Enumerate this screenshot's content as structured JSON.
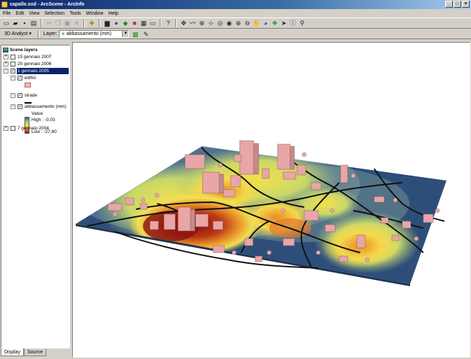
{
  "window": {
    "title": "capalle.sxd - ArcScene - ArcInfo",
    "buttons": [
      "_",
      "□",
      "×"
    ]
  },
  "menu": [
    "File",
    "Edit",
    "View",
    "Selection",
    "Tools",
    "Window",
    "Help"
  ],
  "toolbar2": {
    "analyst": "3D Analyst ▾",
    "layer_label": "Layer:",
    "layer_value": "abbassamento (mm)"
  },
  "toc": {
    "title": "Scene layers",
    "layers": [
      {
        "name": "15 gennaio 2007",
        "checked": false
      },
      {
        "name": "20 gennaio 2006",
        "checked": false
      },
      {
        "name": "1 gennaio 2005",
        "checked": true,
        "selected": true
      },
      {
        "name": "7 gennaio 2004",
        "checked": false
      }
    ],
    "sublayers": {
      "edifici": "edifici",
      "strade": "strade",
      "abbassamento": "abbassamento (mm)",
      "value": "Value",
      "high": "High : -0,03",
      "low": "Low : -27,80"
    }
  },
  "tabs": [
    "Display",
    "Source"
  ],
  "colors": {
    "title_start": "#0a246a",
    "selection": "#0a246a",
    "ramp_high": "#3a5f8a",
    "ramp_mid": "#f6e84a",
    "ramp_low": "#8a0f0f",
    "buildings": "#e8a6a6"
  }
}
